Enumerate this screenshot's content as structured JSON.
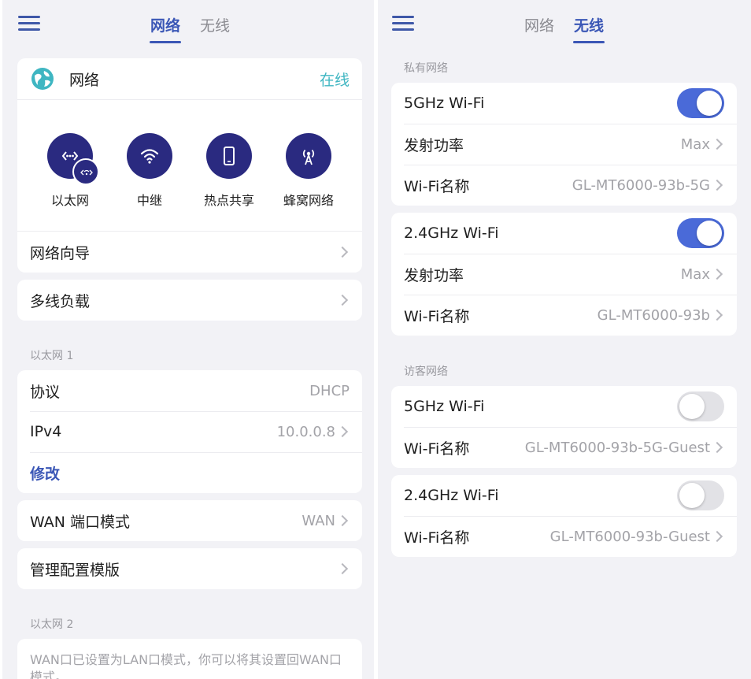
{
  "left": {
    "tabs": [
      {
        "label": "网络",
        "active": true
      },
      {
        "label": "无线",
        "active": false
      }
    ],
    "network_card": {
      "title": "网络",
      "status": "在线",
      "modes": [
        {
          "label": "以太网",
          "icon": "ethernet-icon"
        },
        {
          "label": "中继",
          "icon": "wifi-icon"
        },
        {
          "label": "热点共享",
          "icon": "phone-icon"
        },
        {
          "label": "蜂窝网络",
          "icon": "cellular-icon"
        }
      ],
      "wizard_label": "网络向导"
    },
    "multi_wan_label": "多线负载",
    "ethernet1": {
      "section_title": "以太网 1",
      "protocol_label": "协议",
      "protocol_value": "DHCP",
      "ipv4_label": "IPv4",
      "ipv4_value": "10.0.0.8",
      "modify_label": "修改"
    },
    "wan_port": {
      "label": "WAN 端口模式",
      "value": "WAN"
    },
    "template_label": "管理配置模版",
    "ethernet2": {
      "section_title": "以太网 2",
      "note": "WAN口已设置为LAN口模式，你可以将其设置回WAN口模式。"
    },
    "colors": {
      "accent": "#3b57b6",
      "online": "#3fb6c2",
      "icon_bg": "#2a2a80"
    }
  },
  "right": {
    "tabs": [
      {
        "label": "网络",
        "active": false
      },
      {
        "label": "无线",
        "active": true
      }
    ],
    "private_section_title": "私有网络",
    "guest_section_title": "访客网络",
    "private_5g": {
      "band_label": "5GHz Wi-Fi",
      "enabled": true,
      "power_label": "发射功率",
      "power_value": "Max",
      "ssid_label": "Wi-Fi名称",
      "ssid_value": "GL-MT6000-93b-5G"
    },
    "private_24g": {
      "band_label": "2.4GHz Wi-Fi",
      "enabled": true,
      "power_label": "发射功率",
      "power_value": "Max",
      "ssid_label": "Wi-Fi名称",
      "ssid_value": "GL-MT6000-93b"
    },
    "guest_5g": {
      "band_label": "5GHz Wi-Fi",
      "enabled": false,
      "ssid_label": "Wi-Fi名称",
      "ssid_value": "GL-MT6000-93b-5G-Guest"
    },
    "guest_24g": {
      "band_label": "2.4GHz Wi-Fi",
      "enabled": false,
      "ssid_label": "Wi-Fi名称",
      "ssid_value": "GL-MT6000-93b-Guest"
    },
    "colors": {
      "toggle_on": "#4a6ad8",
      "toggle_off": "#e2e2e6"
    }
  }
}
